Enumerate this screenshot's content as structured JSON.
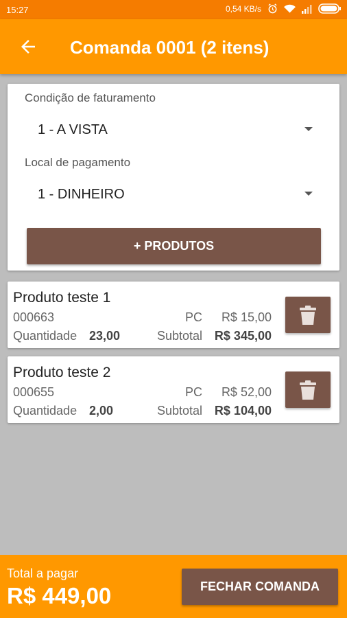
{
  "status_bar": {
    "time": "15:27",
    "network_speed": "0,54 KB/s"
  },
  "app_bar": {
    "title": "Comanda 0001 (2 itens)"
  },
  "billing": {
    "condition_label": "Condição de faturamento",
    "condition_value": "1 - A VISTA",
    "payment_place_label": "Local de pagamento",
    "payment_place_value": "1 - DINHEIRO",
    "add_products_label": "+ PRODUTOS"
  },
  "products": [
    {
      "name": "Produto teste 1",
      "code": "000663",
      "unit": "PC",
      "price": "R$ 15,00",
      "quantity_label": "Quantidade",
      "quantity": "23,00",
      "subtotal_label": "Subtotal",
      "subtotal": "R$ 345,00"
    },
    {
      "name": "Produto teste 2",
      "code": "000655",
      "unit": "PC",
      "price": "R$ 52,00",
      "quantity_label": "Quantidade",
      "quantity": "2,00",
      "subtotal_label": "Subtotal",
      "subtotal": "R$ 104,00"
    }
  ],
  "footer": {
    "total_label": "Total a pagar",
    "total_value": "R$ 449,00",
    "close_button_label": "FECHAR COMANDA"
  },
  "colors": {
    "primary": "#ff9800",
    "primary_dark": "#f57c00",
    "accent_brown": "#795548",
    "background": "#bdbdbd"
  },
  "icons": [
    "back-arrow-icon",
    "alarm-icon",
    "wifi-icon",
    "signal-icon",
    "battery-icon",
    "trash-icon"
  ]
}
